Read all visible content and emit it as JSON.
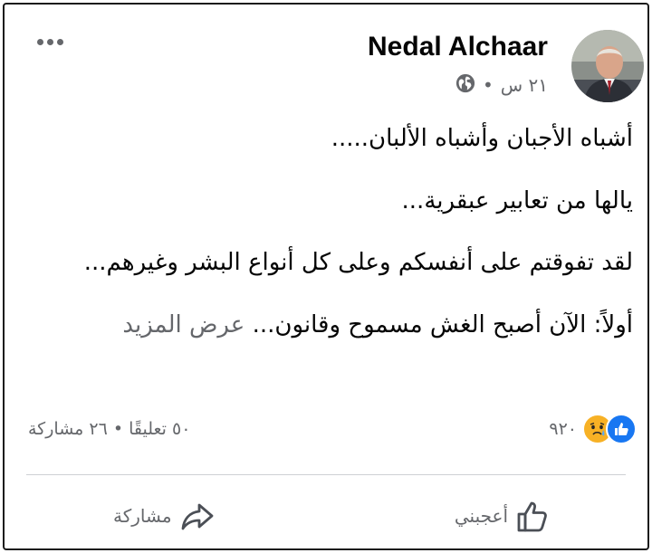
{
  "post": {
    "author": "Nedal Alchaar",
    "time": "٢١ س",
    "separator": "•",
    "privacy_icon": "globe-icon",
    "more_icon": "more-options-icon",
    "paragraphs": [
      "أشباه الأجبان وأشباه الألبان.....",
      "يالها من تعابير عبقرية...",
      "لقد تفوقتم على أنفسكم وعلى كل أنواع البشر وغيرهم..."
    ],
    "last_line": "أولاً: الآن أصبح الغش مسموح  وقانون...",
    "see_more": "عرض المزيد"
  },
  "stats": {
    "reaction_icons": [
      "like-icon",
      "sad-icon"
    ],
    "reaction_count": "٩٢٠",
    "comments_shares": "٥٠ تعليقًا • ٢٦ مشاركة"
  },
  "actions": {
    "like_label": "أعجبني",
    "share_label": "مشاركة"
  },
  "colors": {
    "text": "#050505",
    "secondary": "#65676b",
    "like_blue": "#1877f2",
    "sad_yellow": "#f7b125"
  }
}
